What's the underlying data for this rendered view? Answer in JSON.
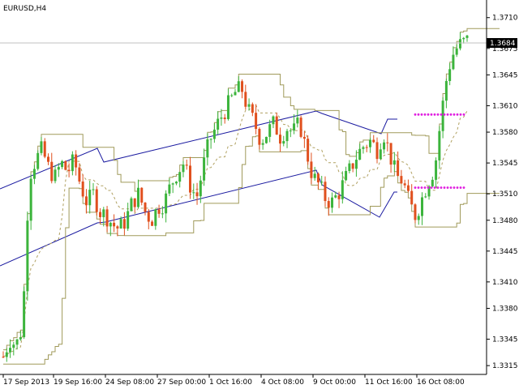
{
  "chart_data": {
    "type": "candlestick",
    "symbol_label": "EURUSD,H4",
    "current_price_label": "1.3684",
    "ylim": [
      1.3305,
      1.373
    ],
    "y_ticks": [
      "1.3710",
      "1.3675",
      "1.3645",
      "1.3610",
      "1.3580",
      "1.3545",
      "1.3510",
      "1.3480",
      "1.3445",
      "1.3410",
      "1.3380",
      "1.3345",
      "1.3315"
    ],
    "x_ticks": [
      "17 Sep 2013",
      "19 Sep 16:00",
      "24 Sep 08:00",
      "27 Sep 00:00",
      "1 Oct 16:00",
      "4 Oct 08:00",
      "9 Oct 00:00",
      "11 Oct 16:00",
      "16 Oct 08:00"
    ],
    "close_path": [
      1.3325,
      1.3345,
      1.3338,
      1.336,
      1.353,
      1.3548,
      1.356,
      1.354,
      1.3528,
      1.3545,
      1.3535,
      1.3548,
      1.352,
      1.35,
      1.351,
      1.349,
      1.3485,
      1.3475,
      1.347,
      1.348,
      1.35,
      1.351,
      1.349,
      1.348,
      1.3495,
      1.35,
      1.352,
      1.3535,
      1.3545,
      1.352,
      1.3505,
      1.354,
      1.357,
      1.3585,
      1.36,
      1.3612,
      1.3625,
      1.363,
      1.3605,
      1.359,
      1.357,
      1.358,
      1.359,
      1.3575,
      1.3585,
      1.358,
      1.359,
      1.356,
      1.353,
      1.352,
      1.3505,
      1.35,
      1.351,
      1.3525,
      1.354,
      1.3555,
      1.3565,
      1.357,
      1.356,
      1.358,
      1.3555,
      1.353,
      1.3525,
      1.35,
      1.3485,
      1.3505,
      1.3525,
      1.354,
      1.36,
      1.365,
      1.3672,
      1.368,
      1.3684
    ],
    "current_price": 1.3684,
    "pivot_marker_levels": [
      1.36,
      1.3517
    ]
  }
}
